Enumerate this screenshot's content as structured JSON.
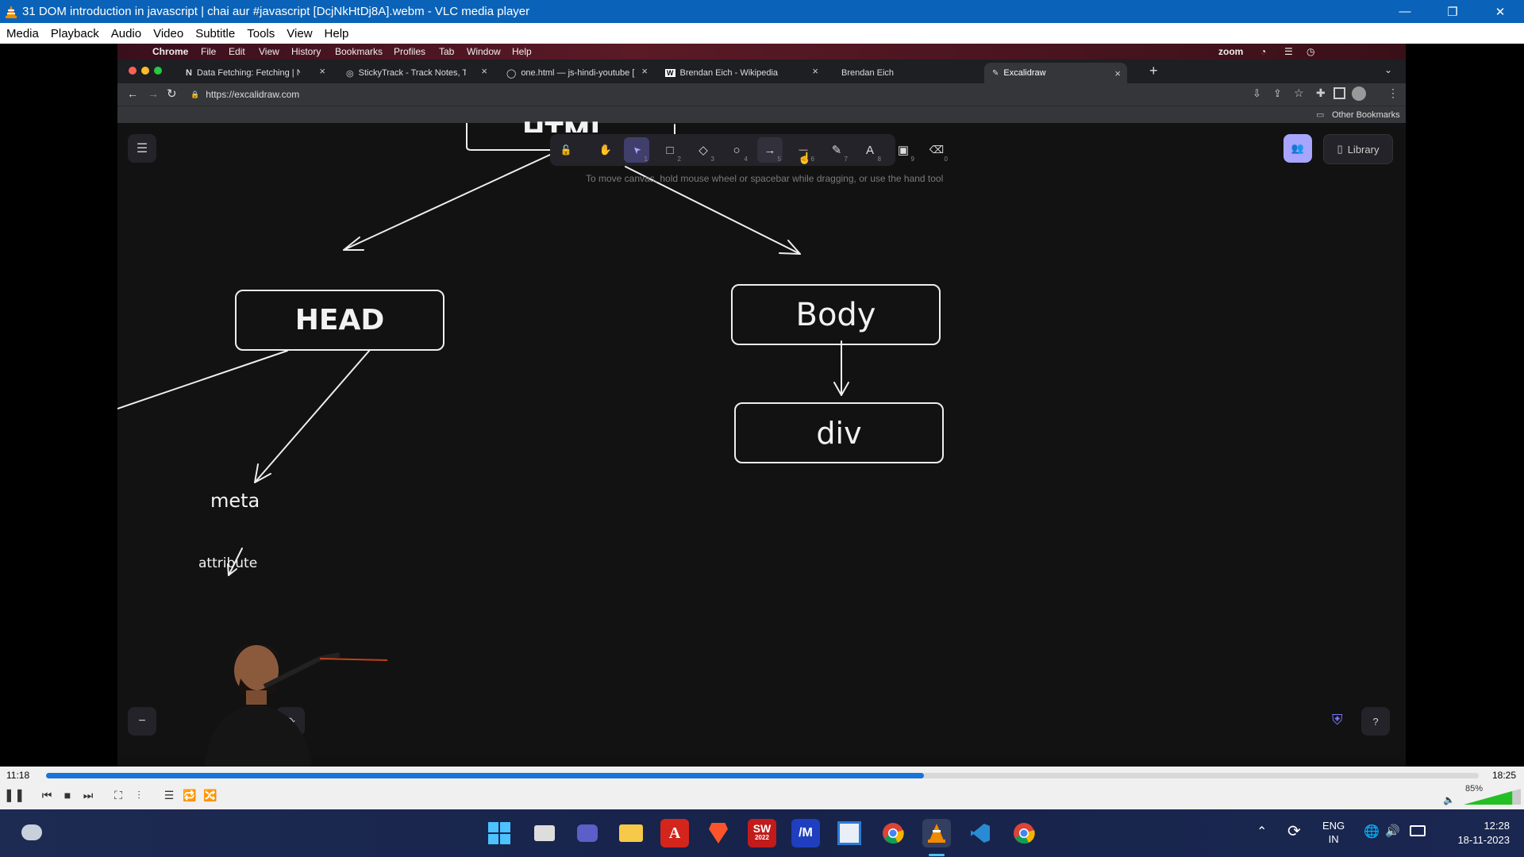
{
  "vlc": {
    "window_title": "31 DOM introduction in javascript  |  chai aur #javascript [DcjNkHtDj8A].webm - VLC media player",
    "menu": [
      "Media",
      "Playback",
      "Audio",
      "Video",
      "Subtitle",
      "Tools",
      "View",
      "Help"
    ],
    "elapsed": "11:18",
    "total": "18:25",
    "progress": 0.613,
    "volume": "85%",
    "volume_level": 0.85
  },
  "mac_menu": {
    "items": [
      "Chrome",
      "File",
      "Edit",
      "View",
      "History",
      "Bookmarks",
      "Profiles",
      "Tab",
      "Window",
      "Help"
    ],
    "right": "zoom"
  },
  "browser": {
    "tabs": [
      {
        "title": "Data Fetching: Fetching | Next",
        "icon": "N"
      },
      {
        "title": "StickyTrack - Track Notes, Trac",
        "icon": "◎"
      },
      {
        "title": "one.html — js-hindi-youtube [",
        "icon": "◯"
      },
      {
        "title": "Brendan Eich - Wikipedia",
        "icon": "W"
      },
      {
        "title": "Brendan Eich",
        "icon": ""
      },
      {
        "title": "Excalidraw",
        "icon": "✎"
      }
    ],
    "url": "https://excalidraw.com",
    "other_bookmarks": "Other Bookmarks"
  },
  "excalidraw": {
    "tools": [
      {
        "name": "lock",
        "glyph": "🔓",
        "key": ""
      },
      {
        "name": "hand",
        "glyph": "✋",
        "key": ""
      },
      {
        "name": "selection",
        "glyph": "➤",
        "key": "1"
      },
      {
        "name": "rectangle",
        "glyph": "□",
        "key": "2"
      },
      {
        "name": "diamond",
        "glyph": "◇",
        "key": "3"
      },
      {
        "name": "ellipse",
        "glyph": "○",
        "key": "4"
      },
      {
        "name": "arrow",
        "glyph": "→",
        "key": "5"
      },
      {
        "name": "line",
        "glyph": "—",
        "key": "6"
      },
      {
        "name": "draw",
        "glyph": "✎",
        "key": "7"
      },
      {
        "name": "text",
        "glyph": "A",
        "key": "8"
      },
      {
        "name": "image",
        "glyph": "▣",
        "key": "9"
      },
      {
        "name": "eraser",
        "glyph": "⌫",
        "key": "0"
      }
    ],
    "hint": "To move canvas, hold mouse wheel or spacebar while dragging, or use the hand tool",
    "library": "Library",
    "zoom_minus": "−",
    "nodes": {
      "html_partial": "HTML",
      "head": "HEAD",
      "body": "Body",
      "div": "div",
      "meta": "meta",
      "attribute": "attribute"
    }
  },
  "taskbar": {
    "lang_top": "ENG",
    "lang_bottom": "IN",
    "time": "12:28",
    "date": "18-11-2023",
    "sw_label": "SW",
    "sw_year": "2022"
  }
}
